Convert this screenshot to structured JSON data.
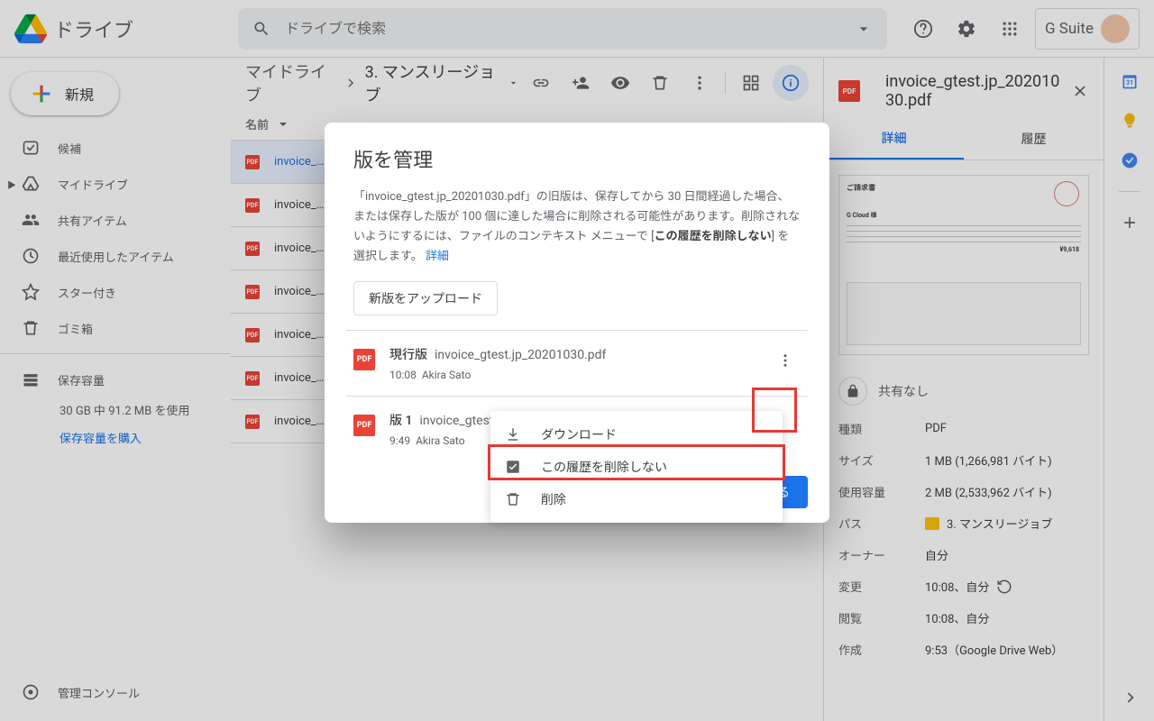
{
  "header": {
    "app_name": "ドライブ",
    "search_placeholder": "ドライブで検索",
    "gsuite": "G Suite"
  },
  "sidebar": {
    "new_label": "新規",
    "items": [
      {
        "label": "候補",
        "icon": "clock-check"
      },
      {
        "label": "マイドライブ",
        "icon": "drive",
        "has_children": true
      },
      {
        "label": "共有アイテム",
        "icon": "people"
      },
      {
        "label": "最近使用したアイテム",
        "icon": "recent"
      },
      {
        "label": "スター付き",
        "icon": "star"
      },
      {
        "label": "ゴミ箱",
        "icon": "trash"
      }
    ],
    "storage_label": "保存容量",
    "storage_text": "30 GB 中 91.2 MB を使用",
    "storage_link": "保存容量を購入",
    "admin": "管理コンソール"
  },
  "breadcrumbs": {
    "root": "マイドライブ",
    "current": "3. マンスリージョブ"
  },
  "columns": {
    "name": "名前"
  },
  "files": [
    {
      "name": "invoice_…",
      "selected": true
    },
    {
      "name": "invoice_…"
    },
    {
      "name": "invoice_…"
    },
    {
      "name": "invoice_…"
    },
    {
      "name": "invoice_…"
    },
    {
      "name": "invoice_…"
    },
    {
      "name": "invoice_…"
    }
  ],
  "details": {
    "title": "invoice_gtest.jp_20201030.pdf",
    "tabs": {
      "detail": "詳細",
      "history": "履歴"
    },
    "preview_title": "ご請求書",
    "preview_company": "G Cloud 様",
    "preview_total": "¥9,618",
    "share": "共有なし",
    "meta": [
      {
        "label": "種類",
        "value": "PDF"
      },
      {
        "label": "サイズ",
        "value": "1 MB (1,266,981 バイト)"
      },
      {
        "label": "使用容量",
        "value": "2 MB (2,533,962 バイト)"
      },
      {
        "label": "パス",
        "value": "3. マンスリージョブ",
        "folder": true
      },
      {
        "label": "オーナー",
        "value": "自分"
      },
      {
        "label": "変更",
        "value": "10:08、自分",
        "restore": true
      },
      {
        "label": "閲覧",
        "value": "10:08、自分"
      },
      {
        "label": "作成",
        "value": "9:53（Google Drive Web）"
      }
    ]
  },
  "dialog": {
    "title": "版を管理",
    "desc_pre": "「invoice_gtest.jp_20201030.pdf」の旧版は、保存してから 30 日間経過した場合、または保存した版が 100 個に達した場合に削除される可能性があります。削除されないようにするには、ファイルのコンテキスト メニューで [",
    "desc_bold": "この履歴を削除しない",
    "desc_post": "] を選択します。 ",
    "learn_more": "詳細",
    "upload": "新版をアップロード",
    "versions": [
      {
        "label": "現行版",
        "name": "invoice_gtest.jp_20201030.pdf",
        "time": "10:08",
        "user": "Akira Sato",
        "more": true
      },
      {
        "label": "版 1",
        "name": "invoice_gtest.jp_20201030.pdf",
        "time": "9:49",
        "user": "Akira Sato"
      }
    ],
    "close": "閉じる"
  },
  "context_menu": {
    "items": [
      {
        "label": "ダウンロード",
        "icon": "download"
      },
      {
        "label": "この履歴を削除しない",
        "icon": "checkbox"
      },
      {
        "label": "削除",
        "icon": "delete"
      }
    ]
  }
}
